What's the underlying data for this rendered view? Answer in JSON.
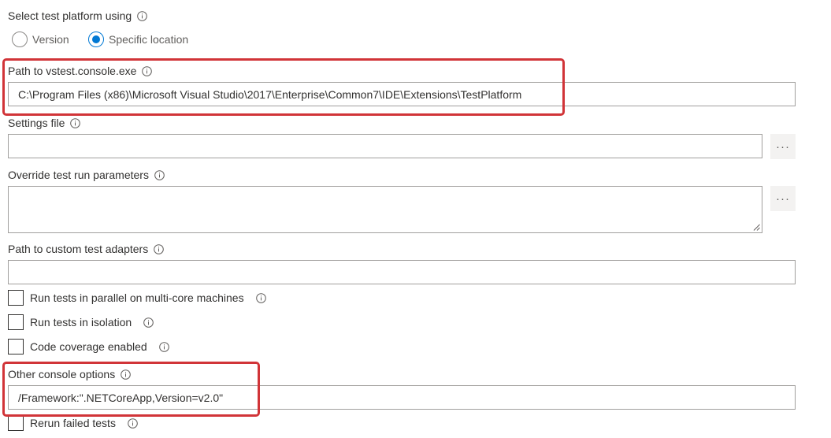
{
  "platform": {
    "label": "Select test platform using",
    "options": [
      {
        "label": "Version",
        "selected": false
      },
      {
        "label": "Specific location",
        "selected": true
      }
    ]
  },
  "vstest_path": {
    "label": "Path to vstest.console.exe",
    "value": "C:\\Program Files (x86)\\Microsoft Visual Studio\\2017\\Enterprise\\Common7\\IDE\\Extensions\\TestPlatform"
  },
  "settings_file": {
    "label": "Settings file",
    "value": "",
    "more_label": "···"
  },
  "override_params": {
    "label": "Override test run parameters",
    "value": "",
    "more_label": "···"
  },
  "custom_adapters": {
    "label": "Path to custom test adapters",
    "value": ""
  },
  "checkboxes": [
    {
      "label": "Run tests in parallel on multi-core machines",
      "checked": false
    },
    {
      "label": "Run tests in isolation",
      "checked": false
    },
    {
      "label": "Code coverage enabled",
      "checked": false
    }
  ],
  "console_options": {
    "label": "Other console options",
    "value": "/Framework:\".NETCoreApp,Version=v2.0\""
  },
  "rerun": {
    "label": "Rerun failed tests",
    "checked": false
  },
  "colors": {
    "accent": "#0078d4",
    "highlight": "#d13438"
  }
}
